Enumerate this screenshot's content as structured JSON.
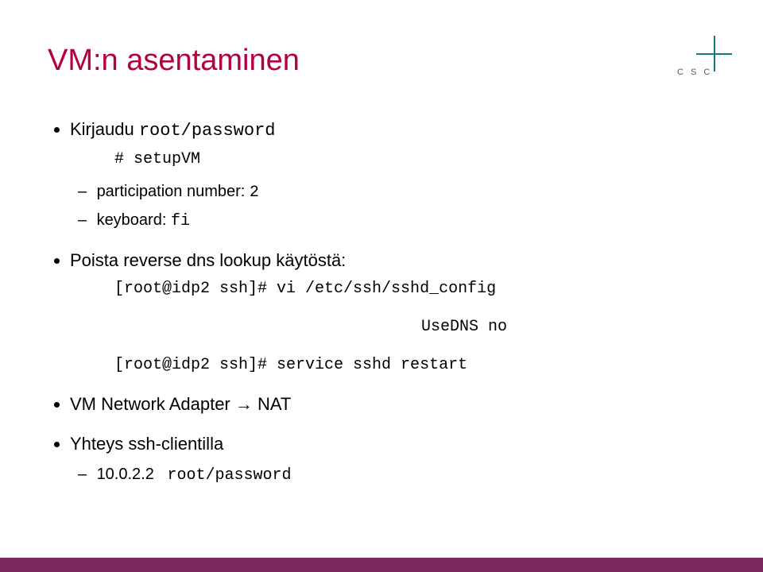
{
  "logo": {
    "text": "C S C"
  },
  "title": "VM:n asentaminen",
  "bullets": {
    "login_label": "Kirjaudu ",
    "login_cred": "root/password",
    "setup_cmd": "# setupVM",
    "participation_label": "participation number: ",
    "participation_value": "2",
    "keyboard_label": "keyboard: ",
    "keyboard_value": "fi",
    "dns_off": "Poista reverse dns lookup käytöstä:",
    "cmd1": "[root@idp2 ssh]# vi /etc/ssh/sshd_config",
    "usedns": "UseDNS no",
    "cmd2": "[root@idp2 ssh]# service sshd restart",
    "adapter": "VM Network Adapter → NAT",
    "ssh_client": "Yhteys ssh-clientilla",
    "ip_label": "10.0.2.2",
    "ip_cred": "root/password"
  }
}
